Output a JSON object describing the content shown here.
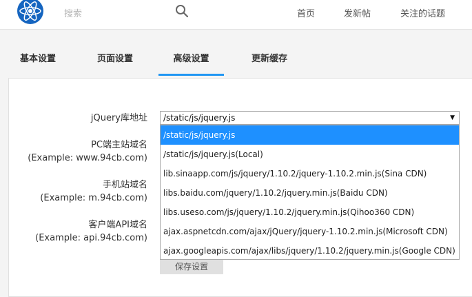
{
  "header": {
    "search_placeholder": "搜索",
    "nav": [
      "首页",
      "发新帖",
      "关注的话题"
    ]
  },
  "tabs": [
    {
      "label": "基本设置",
      "active": false
    },
    {
      "label": "页面设置",
      "active": false
    },
    {
      "label": "高级设置",
      "active": true
    },
    {
      "label": "更新缓存",
      "active": false
    }
  ],
  "form": {
    "jquery_label": "jQuery库地址",
    "pc_domain_label": "PC端主站域名",
    "pc_domain_example": "(Example:  www.94cb.com)",
    "mobile_domain_label": "手机站域名",
    "mobile_domain_example": "(Example:  m.94cb.com)",
    "api_domain_label": "客户端API域名",
    "api_domain_example": "(Example:  api.94cb.com)",
    "select_value": "/static/js/jquery.js",
    "options": [
      "/static/js/jquery.js",
      "/static/js/jquery.js(Local)",
      "lib.sinaapp.com/js/jquery/1.10.2/jquery-1.10.2.min.js(Sina CDN)",
      "libs.baidu.com/jquery/1.10.2/jquery.min.js(Baidu CDN)",
      "libs.useso.com/js/jquery/1.10.2/jquery.min.js(Qihoo360 CDN)",
      "ajax.aspnetcdn.com/ajax/jQuery/jquery-1.10.2.min.js(Microsoft CDN)",
      "ajax.googleapis.com/ajax/libs/jquery/1.10.2/jquery.min.js(Google CDN)"
    ],
    "save_label": "保存设置"
  },
  "colors": {
    "accent": "#2196f3",
    "selected_option": "#1e90ff",
    "logo": "#1565c0"
  }
}
